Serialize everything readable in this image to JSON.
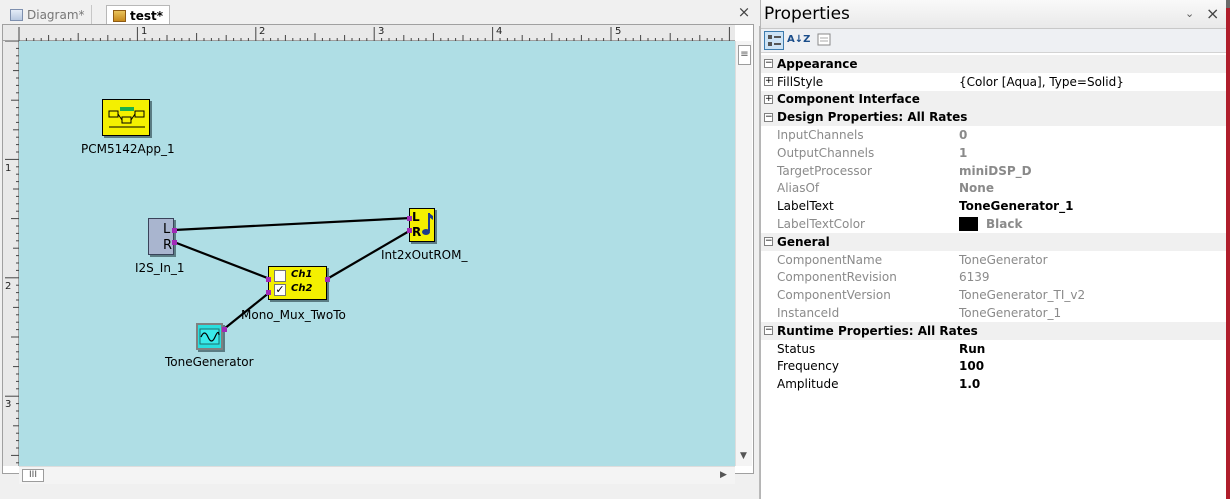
{
  "tabs": [
    {
      "label": "Diagram*",
      "icon": "diagram-icon",
      "active": false
    },
    {
      "label": "test*",
      "icon": "test-icon",
      "active": true
    }
  ],
  "ruler": {
    "top_numbers": [
      "1",
      "2",
      "3",
      "4",
      "5"
    ],
    "left_numbers": [
      "1",
      "2",
      "3"
    ]
  },
  "components": {
    "app": {
      "label": "PCM5142App_1"
    },
    "i2s_in": {
      "label": "I2S_In_1",
      "letter_l": "L",
      "letter_r": "R"
    },
    "mux": {
      "label": "Mono_Mux_TwoTo",
      "ch1": "Ch1",
      "ch2": "Ch2"
    },
    "output": {
      "label": "Int2xOutROM_",
      "letter_l": "L",
      "letter_r": "R"
    },
    "tone": {
      "label": "ToneGenerator"
    }
  },
  "properties": {
    "title": "Properties",
    "pin_glyph": "¥",
    "close_glyph": "×",
    "toolbar": {
      "categorized": "categorized-icon",
      "alpha_label": "A↓Z",
      "pages": "property-pages-icon"
    },
    "rows": [
      {
        "type": "cat",
        "expander": "⊟",
        "name": "Appearance"
      },
      {
        "type": "prop",
        "expander": "⊞",
        "name": "FillStyle",
        "value": "{Color [Aqua], Type=Solid}",
        "ro": false,
        "bold": false
      },
      {
        "type": "cat",
        "expander": "⊞",
        "name": "Component Interface"
      },
      {
        "type": "cat",
        "expander": "⊟",
        "name": "Design Properties: All Rates"
      },
      {
        "type": "prop",
        "name": "InputChannels",
        "value": "0",
        "ro": true,
        "bold": true
      },
      {
        "type": "prop",
        "name": "OutputChannels",
        "value": "1",
        "ro": true,
        "bold": true
      },
      {
        "type": "prop",
        "name": "TargetProcessor",
        "value": "miniDSP_D",
        "ro": true,
        "bold": true
      },
      {
        "type": "prop",
        "name": "AliasOf",
        "value": "None",
        "ro": true,
        "bold": true
      },
      {
        "type": "prop",
        "name": "LabelText",
        "value": "ToneGenerator_1",
        "ro": false,
        "bold": true
      },
      {
        "type": "prop",
        "name": "LabelTextColor",
        "value": "Black",
        "ro": true,
        "bold": true,
        "swatch": "#000000"
      },
      {
        "type": "cat",
        "expander": "⊟",
        "name": "General"
      },
      {
        "type": "prop",
        "name": "ComponentName",
        "value": "ToneGenerator",
        "ro": true,
        "bold": false
      },
      {
        "type": "prop",
        "name": "ComponentRevision",
        "value": "6139",
        "ro": true,
        "bold": false
      },
      {
        "type": "prop",
        "name": "ComponentVersion",
        "value": "ToneGenerator_TI_v2",
        "ro": true,
        "bold": false
      },
      {
        "type": "prop",
        "name": "InstanceId",
        "value": "ToneGenerator_1",
        "ro": true,
        "bold": false
      },
      {
        "type": "cat",
        "expander": "⊟",
        "name": "Runtime Properties: All Rates"
      },
      {
        "type": "prop",
        "name": "Status",
        "value": "Run",
        "ro": false,
        "bold": true
      },
      {
        "type": "prop",
        "name": "Frequency",
        "value": "100",
        "ro": false,
        "bold": true
      },
      {
        "type": "prop",
        "name": "Amplitude",
        "value": "1.0",
        "ro": false,
        "bold": true
      }
    ]
  },
  "colors": {
    "canvas_bg": "#afdee5",
    "block_yellow": "#f4f000",
    "port": "#a12ab8",
    "tone_block": "#29dede"
  },
  "scroll": {
    "hthumb_glyph": "III",
    "vthumb_glyph": "≡"
  }
}
